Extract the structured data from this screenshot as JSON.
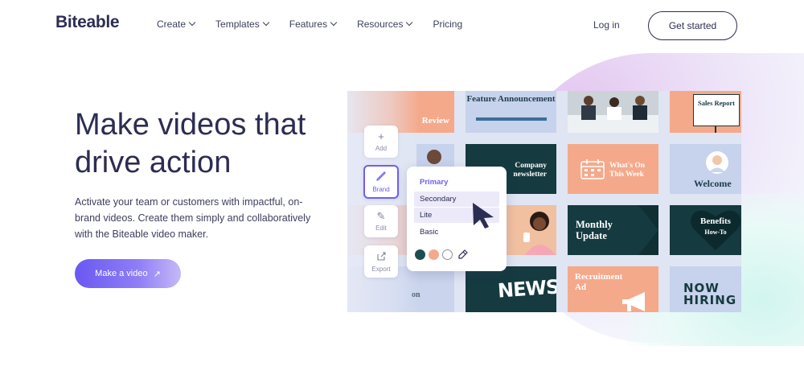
{
  "brand": {
    "logo": "Biteable"
  },
  "nav": {
    "items": [
      {
        "label": "Create",
        "has_dropdown": true
      },
      {
        "label": "Templates",
        "has_dropdown": true
      },
      {
        "label": "Features",
        "has_dropdown": true
      },
      {
        "label": "Resources",
        "has_dropdown": true
      },
      {
        "label": "Pricing",
        "has_dropdown": false
      }
    ],
    "login": "Log in",
    "get_started": "Get started"
  },
  "hero": {
    "headline_line1": "Make videos that",
    "headline_line2": "drive action",
    "subtext": "Activate your team or customers with impactful, on-brand videos. Create them simply and collaboratively with the Biteable video maker.",
    "cta_label": "Make a video",
    "cta_icon": "arrow-up-right-icon"
  },
  "editor": {
    "toolbar": [
      {
        "label": "Add",
        "icon": "plus-icon"
      },
      {
        "label": "Brand",
        "icon": "brush-icon",
        "active": true
      },
      {
        "label": "Edit",
        "icon": "pencil-icon"
      },
      {
        "label": "Export",
        "icon": "export-icon"
      }
    ],
    "brand_menu": {
      "options": [
        "Primary",
        "Secondary",
        "Lite",
        "Basic"
      ],
      "selected": "Primary",
      "hovered": "Secondary"
    },
    "swatches": [
      "#1e4d4e",
      "#f5a98b",
      "#ffffff"
    ],
    "swatch_tool_icon": "eyedropper-icon"
  },
  "templates": {
    "review": "Review",
    "feature_announcement": "Feature Announcement",
    "sales_report": "Sales Report",
    "company_newsletter_line1": "Company",
    "company_newsletter_line2": "newsletter",
    "whats_on_line1": "What's On",
    "whats_on_line2": "This Week",
    "welcome": "Welcome",
    "monthly_update_line1": "Monthly",
    "monthly_update_line2": "Update",
    "benefits_line1": "Benefits",
    "benefits_line2": "How-To",
    "recruitment_line1": "Recruitment",
    "recruitment_line2": "Ad",
    "news": "NEWS",
    "now_hiring_line1": "NOW",
    "now_hiring_line2": "HIRING",
    "partial_left": "on"
  },
  "colors": {
    "navy": "#153a3f",
    "peach": "#f5a98b",
    "lavender": "#c7d2ec",
    "accent": "#6f60f0"
  }
}
